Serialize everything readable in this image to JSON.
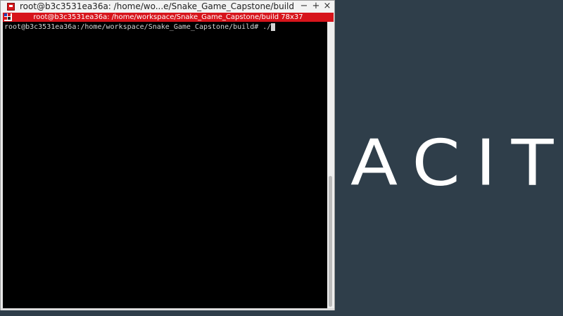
{
  "window": {
    "title": "root@b3c3531ea36a: /home/wo...e/Snake_Game_Capstone/build",
    "minimize_label": "−",
    "maximize_label": "+",
    "close_label": "×"
  },
  "xterm": {
    "title": "root@b3c3531ea36a: /home/workspace/Snake_Game_Capstone/build 78x37"
  },
  "terminal": {
    "prompt": "root@b3c3531ea36a:/home/workspace/Snake_Game_Capstone/build# ./"
  },
  "desktop": {
    "wallpaper_text": "ACIT",
    "background_color": "#2f3e4a"
  },
  "colors": {
    "xterm_bar": "#d7141b",
    "terminal_bg": "#000000",
    "terminal_fg": "#d4d4d4"
  },
  "icons": {
    "app": "terminal-app-icon",
    "xterm": "xterm-grid-icon",
    "panel": "panel-expand-arrow-icon"
  }
}
